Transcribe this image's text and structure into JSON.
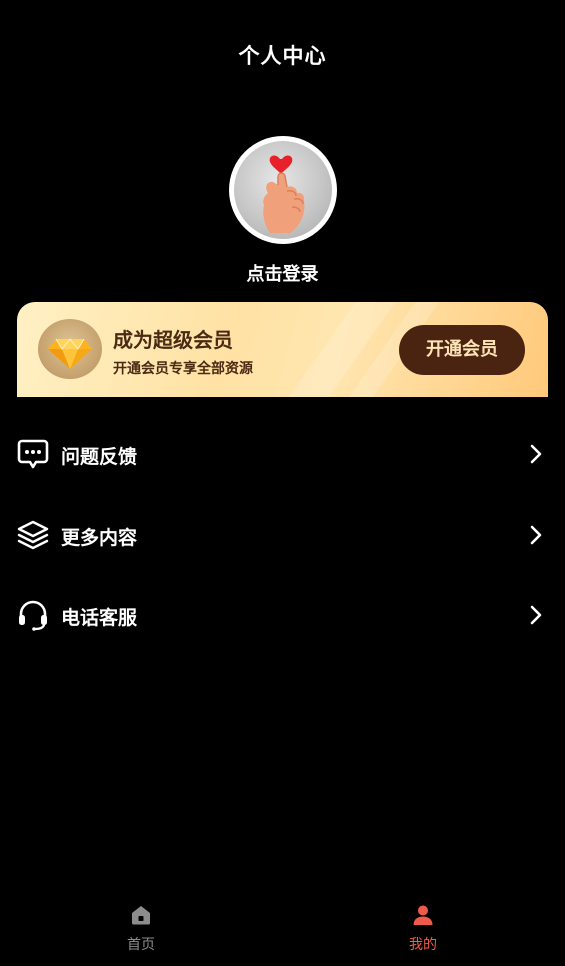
{
  "header": {
    "title": "个人中心"
  },
  "profile": {
    "login_text": "点击登录"
  },
  "vip": {
    "title": "成为超级会员",
    "subtitle": "开通会员专享全部资源",
    "button_label": "开通会员"
  },
  "menu": [
    {
      "label": "问题反馈",
      "icon": "feedback-message-icon"
    },
    {
      "label": "更多内容",
      "icon": "layers-icon"
    },
    {
      "label": "电话客服",
      "icon": "headset-icon"
    }
  ],
  "tabbar": {
    "tabs": [
      {
        "label": "首页",
        "icon": "home-icon",
        "active": false
      },
      {
        "label": "我的",
        "icon": "user-icon",
        "active": true
      }
    ]
  },
  "colors": {
    "background": "#000000",
    "active_tab": "#f05a4a",
    "inactive_tab": "#8c8c8c",
    "vip_button_bg": "#4a2410",
    "vip_text": "#4a2a12"
  }
}
